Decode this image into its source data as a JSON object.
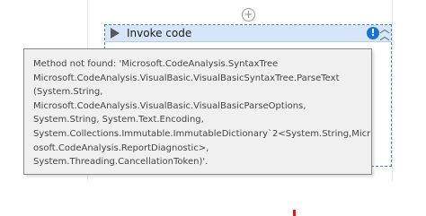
{
  "workflow": {
    "add_activity_icon": "plus-circle-icon",
    "activity": {
      "title": "Invoke code",
      "status_icon": "error-icon",
      "status_symbol": "!",
      "collapse_symbol": "︿",
      "header_color": "#d6e6f8",
      "border_color": "#4a7ec2"
    }
  },
  "tooltip": {
    "lines": [
      "Method not found: 'Microsoft.CodeAnalysis.SyntaxTree",
      "Microsoft.CodeAnalysis.VisualBasic.VisualBasicSyntaxTree.ParseText",
      "(System.String,",
      "Microsoft.CodeAnalysis.VisualBasic.VisualBasicParseOptions,",
      "System.String, System.Text.Encoding,",
      "System.Collections.Immutable.ImmutableDictionary`2<System.String,Micr",
      "osoft.CodeAnalysis.ReportDiagnostic>,",
      "System.Threading.CancellationToken)'."
    ]
  },
  "colors": {
    "error_accent": "#1a72d0",
    "red_mark": "#e11b1b"
  }
}
